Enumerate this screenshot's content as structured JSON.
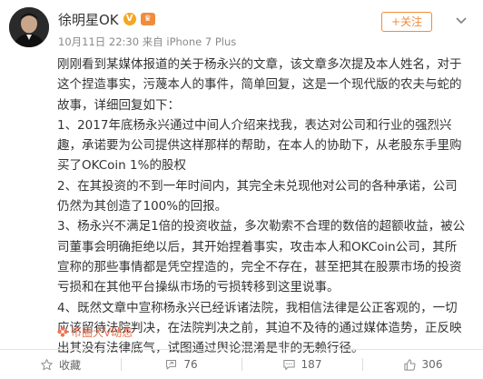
{
  "user": {
    "name": "徐明星OK",
    "verified_icon": "verified-badge-icon",
    "level_icon": "member-level-icon"
  },
  "header": {
    "follow_label": "+关注",
    "meta": "10月11日 22:30 来自 iPhone 7 Plus"
  },
  "post": {
    "paragraphs": [
      "刚刚看到某媒体报道的关于杨永兴的文章，该文章多次提及本人姓名，对于这个捏造事实，污蔑本人的事件，简单回复，这是一个现代版的农夫与蛇的故事，详细回复如下：",
      "1、2017年底杨永兴通过中间人介绍来找我，表达对公司和行业的强烈兴趣，承诺要为公司提供这样那样的帮助，在本人的协助下，从老股东手里购买了OKCoin 1%的股权",
      "2、在其投资的不到一年时间内，其完全未兑现他对公司的各种承诺，公司仍然为其创造了100%的回报。",
      "3、杨永兴不满足1倍的投资收益，多次勒索不合理的数倍的超额收益，被公司董事会明确拒绝以后，其开始捏着事实，攻击本人和OKCoin公司，其所宣称的那些事情都是凭空捏造的，完全不存在，甚至把其在股票市场的投资亏损和在其他平台操纵市场的亏损转移到这里说事。",
      "4、既然文章中宣称杨永兴已经诉诸法院，我相信法律是公正客观的，一切应该留待法院判决，在法院判决之前，其迫不及待的通过媒体造势，正反映出其没有法律底气，试图通过舆论混淆是非的无赖行径。"
    ],
    "source_label": "币圈大V动态"
  },
  "actions": {
    "favorite_label": "收藏",
    "repost_count": "76",
    "comment_count": "187",
    "like_count": "306"
  },
  "colors": {
    "accent": "#f08c3c",
    "source_link": "#eb7350",
    "meta_gray": "#8a8a8a",
    "text": "#333333"
  }
}
